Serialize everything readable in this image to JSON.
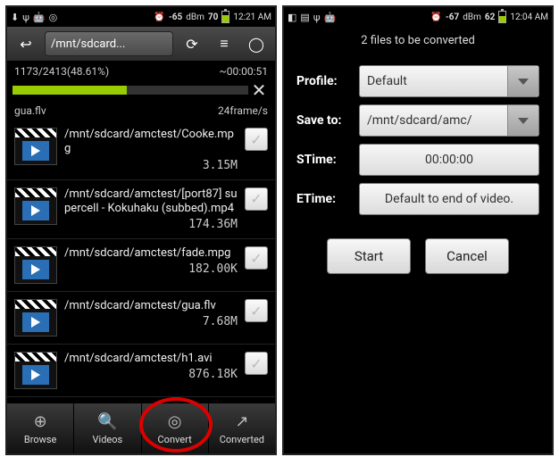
{
  "left": {
    "status": {
      "signal": "-65",
      "unit": "dBm",
      "battery": "70",
      "time": "12:21 AM",
      "battery_pct": 70
    },
    "toolbar": {
      "path": "/mnt/sdcard..."
    },
    "progress": {
      "text": "1173/2413(48.61%)",
      "eta": "~00:00:51",
      "percent": 48.61,
      "file": "gua.flv",
      "rate": "24frame/s"
    },
    "items": [
      {
        "path": "/mnt/sdcard/amctest/Cooke.mpg",
        "size": "3.15M"
      },
      {
        "path": "/mnt/sdcard/amctest/[port87] supercell - Kokuhaku (subbed).mp4",
        "size": "174.36M"
      },
      {
        "path": "/mnt/sdcard/amctest/fade.mpg",
        "size": "182.00K"
      },
      {
        "path": "/mnt/sdcard/amctest/gua.flv",
        "size": "7.68M"
      },
      {
        "path": "/mnt/sdcard/amctest/h1.avi",
        "size": "876.18K"
      }
    ],
    "nav": {
      "browse": "Browse",
      "videos": "Videos",
      "convert": "Convert",
      "converted": "Converted"
    }
  },
  "right": {
    "status": {
      "signal": "-67",
      "unit": "dBm",
      "battery": "62",
      "time": "12:04 AM",
      "battery_pct": 62
    },
    "header": "2  files to be converted",
    "form": {
      "profile_label": "Profile:",
      "profile_value": "Default",
      "saveto_label": "Save to:",
      "saveto_value": "/mnt/sdcard/amc/",
      "stime_label": "STime:",
      "stime_value": "00:00:00",
      "etime_label": "ETime:",
      "etime_value": "Default to end of video."
    },
    "buttons": {
      "start": "Start",
      "cancel": "Cancel"
    }
  }
}
